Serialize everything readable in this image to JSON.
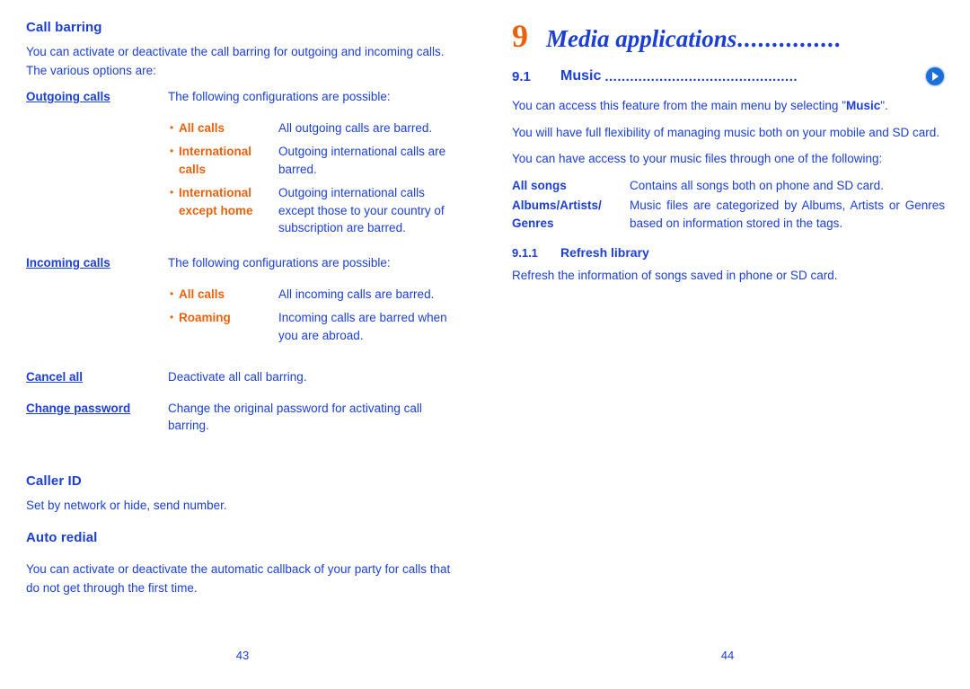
{
  "colors": {
    "blue": "#1b3fd3",
    "orange": "#e8620d",
    "badge_blue": "#1b6fd8"
  },
  "left_page": {
    "folio": "43",
    "section_title": "Call barring",
    "intro": "You can activate or deactivate the call barring for outgoing and incoming calls. The various options are:",
    "rows": [
      {
        "term": "Outgoing calls",
        "desc": "The following configurations are possible:",
        "sub": [
          {
            "term": "All calls",
            "desc": "All outgoing calls are barred."
          },
          {
            "term": "International calls",
            "desc": "Outgoing international calls are barred."
          },
          {
            "term": "International except home",
            "desc": "Outgoing international calls except those to your country of subscription are barred."
          }
        ]
      },
      {
        "term": "Incoming calls",
        "desc": "The following configurations are possible:",
        "sub": [
          {
            "term": "All calls",
            "desc": "All incoming calls are barred."
          },
          {
            "term": "Roaming",
            "desc": "Incoming calls are barred when you are abroad."
          }
        ]
      },
      {
        "term": "Cancel all",
        "desc": "Deactivate all call barring.",
        "sub": []
      },
      {
        "term": "Change password",
        "desc": "Change the original password for activating call barring.",
        "sub": []
      }
    ],
    "caller_id_title": "Caller ID",
    "caller_id_body": "Set by network or hide, send number.",
    "auto_redial_title": "Auto redial",
    "auto_redial_body": "You can activate or deactivate the automatic callback of your party for calls that do not get through the first time."
  },
  "right_page": {
    "folio": "44",
    "chapter_number": "9",
    "chapter_title": "Media applications",
    "chapter_dots": "...............",
    "section_number": "9.1",
    "section_title": "Music",
    "section_dots": "..............................................",
    "section_icon": "play-circle-icon",
    "para1_pre": "You can access this feature from the main menu by selecting \"",
    "para1_bold": "Music",
    "para1_post": "\".",
    "para2": "You will have full flexibility of managing music both on your mobile and SD card.",
    "para3": "You can have access to your music files through one of the following:",
    "rows": [
      {
        "term": "All songs",
        "desc": "Contains all songs both on phone and SD card."
      },
      {
        "term": "Albums/Artists/ Genres",
        "desc": "Music files are categorized by Albums, Artists or Genres based on information stored in the tags."
      }
    ],
    "subsection_number": "9.1.1",
    "subsection_title": "Refresh library",
    "subsection_body": "Refresh the information of songs saved in phone or SD card."
  }
}
